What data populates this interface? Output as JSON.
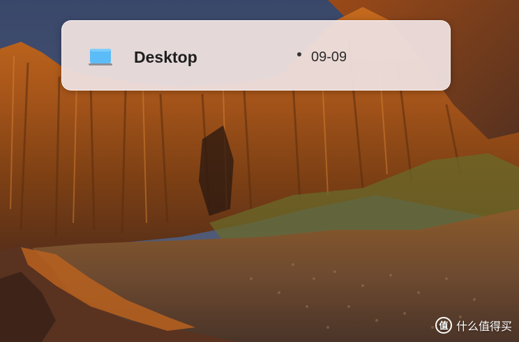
{
  "file_entry": {
    "name": "Desktop",
    "icon": "folder-icon",
    "date": "09-09"
  },
  "watermark": {
    "text": "什么值得买",
    "icon": "watermark-logo-icon"
  },
  "colors": {
    "card_background": "#ecdedd",
    "folder_icon": "#4fb1f4"
  }
}
